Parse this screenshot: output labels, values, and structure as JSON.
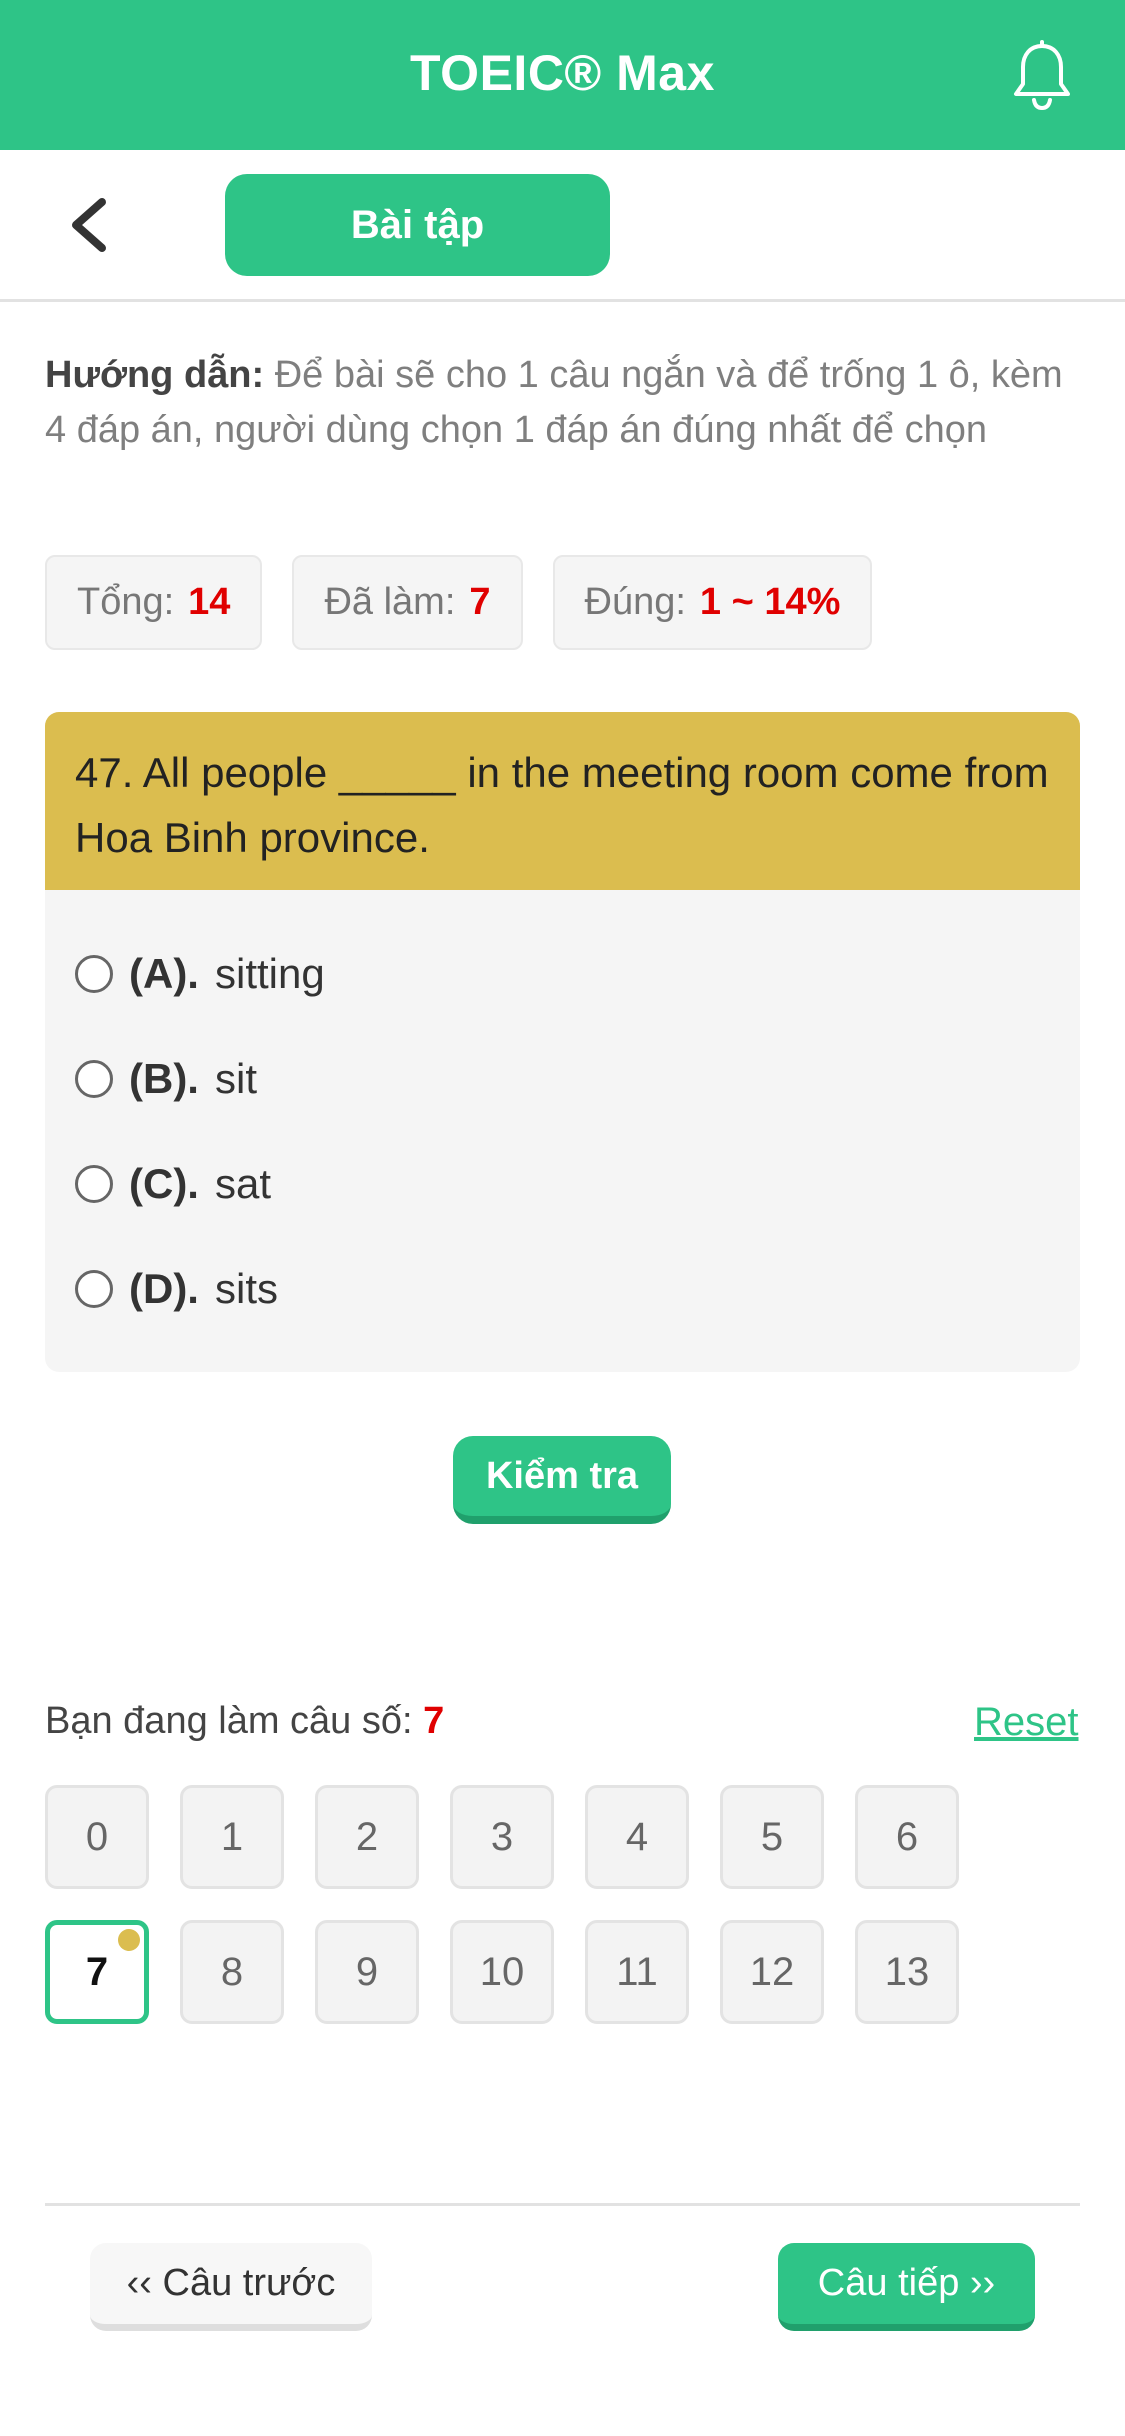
{
  "header": {
    "title": "TOEIC® Max",
    "icon": "bell-icon"
  },
  "nav": {
    "back_icon": "chevron-left-icon",
    "tab_label": "Bài tập"
  },
  "guide": {
    "label": "Hướng dẫn:",
    "text": "Để bài sẽ cho 1 câu ngắn và để trống 1 ô, kèm 4 đáp án, người dùng chọn 1 đáp án đúng nhất để chọn"
  },
  "stats": {
    "total_label": "Tổng:",
    "total_value": "14",
    "done_label": "Đã làm:",
    "done_value": "7",
    "correct_label": "Đúng:",
    "correct_value": "1 ~ 14%"
  },
  "question": {
    "text": "47. All people _____ in the meeting room come from Hoa Binh province.",
    "options": [
      {
        "letter": "(A).",
        "text": "sitting"
      },
      {
        "letter": "(B).",
        "text": "sit"
      },
      {
        "letter": "(C).",
        "text": "sat"
      },
      {
        "letter": "(D).",
        "text": "sits"
      }
    ]
  },
  "check_label": "Kiểm tra",
  "progress": {
    "label": "Bạn đang làm câu số:",
    "current": "7",
    "reset_label": "Reset",
    "numbers": [
      "0",
      "1",
      "2",
      "3",
      "4",
      "5",
      "6",
      "7",
      "8",
      "9",
      "10",
      "11",
      "12",
      "13"
    ]
  },
  "footer": {
    "prev_label": "‹‹ Câu trước",
    "next_label": "Câu tiếp ››"
  },
  "colors": {
    "primary": "#2ec487",
    "question_bg": "#dbbd4f",
    "highlight": "#e00000"
  }
}
